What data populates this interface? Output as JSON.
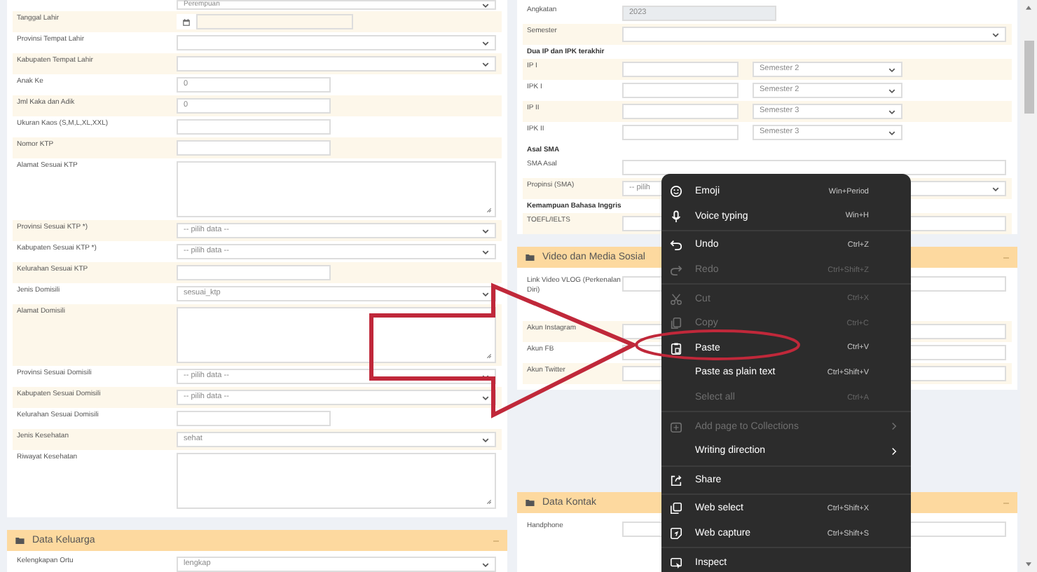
{
  "left_panel": {
    "fields": [
      {
        "kind": "select",
        "value": "Perempuan"
      },
      {
        "label": "Tanggal Lahir",
        "kind": "date"
      },
      {
        "label": "Provinsi Tempat Lahir",
        "kind": "select"
      },
      {
        "label": "Kabupaten Tempat Lahir",
        "kind": "select"
      },
      {
        "label": "Anak Ke",
        "kind": "short_input",
        "value": "0"
      },
      {
        "label": "Jml Kaka dan Adik",
        "kind": "short_input",
        "value": "0"
      },
      {
        "label": "Ukuran Kaos (S,M,L,XL,XXL)",
        "kind": "short_input"
      },
      {
        "label": "Nomor KTP",
        "kind": "short_input"
      },
      {
        "label": "Alamat Sesuai KTP",
        "kind": "textarea"
      },
      {
        "label": "Provinsi Sesuai KTP *)",
        "kind": "select",
        "value": "-- pilih data --"
      },
      {
        "label": "Kabupaten Sesuai KTP *)",
        "kind": "select",
        "value": "-- pilih data --"
      },
      {
        "label": "Kelurahan Sesuai KTP",
        "kind": "short_input"
      },
      {
        "label": "Jenis Domisili",
        "kind": "select",
        "value": "sesuai_ktp"
      },
      {
        "label": "Alamat Domisili",
        "kind": "textarea"
      },
      {
        "label": "Provinsi Sesuai Domisili",
        "kind": "select",
        "value": "-- pilih data --"
      },
      {
        "label": "Kabupaten Sesuai Domisili",
        "kind": "select",
        "value": "-- pilih data --"
      },
      {
        "label": "Kelurahan Sesuai Domisili",
        "kind": "short_input"
      },
      {
        "label": "Jenis Kesehatan",
        "kind": "select",
        "value": "sehat"
      },
      {
        "label": "Riwayat Kesehatan",
        "kind": "textarea"
      }
    ]
  },
  "left_sections": [
    {
      "title": "Data Keluarga",
      "fields": [
        {
          "label": "Kelengkapan Ortu",
          "kind": "select",
          "value": "lengkap"
        }
      ]
    }
  ],
  "right_panel": {
    "fields": [
      {
        "label": "Angkatan",
        "kind": "short_input",
        "value": "2023",
        "disabled": true
      },
      {
        "label": "Semester",
        "kind": "select"
      },
      {
        "label": "Dua IP dan IPK terakhir",
        "kind": "heading"
      },
      {
        "label": "IP I",
        "kind": "input_select",
        "value": "Semester 2"
      },
      {
        "label": "IPK I",
        "kind": "input_select",
        "value": "Semester 2"
      },
      {
        "label": "IP II",
        "kind": "input_select",
        "value": "Semester 3"
      },
      {
        "label": "IPK II",
        "kind": "input_select",
        "value": "Semester 3"
      },
      {
        "label": "Asal SMA",
        "kind": "heading"
      },
      {
        "label": "SMA Asal",
        "kind": "input"
      },
      {
        "label": "Propinsi (SMA)",
        "kind": "select",
        "value": "-- pilih"
      },
      {
        "label": "Kemampuan Bahasa Inggris",
        "kind": "heading"
      },
      {
        "label": "TOEFL/IELTS",
        "kind": "input"
      }
    ]
  },
  "right_sections": [
    {
      "title": "Video dan Media Sosial",
      "fields": [
        {
          "label": "Link Video VLOG (Perkenalan Diri)",
          "kind": "input"
        },
        {
          "label": "Akun Instagram",
          "kind": "input"
        },
        {
          "label": "Akun FB",
          "kind": "input"
        },
        {
          "label": "Akun Twitter",
          "kind": "input"
        }
      ]
    },
    {
      "title": "Data Kontak",
      "fields": [
        {
          "label": "Handphone",
          "kind": "input"
        }
      ]
    }
  ],
  "context_menu": {
    "groups": [
      [
        {
          "label": "Emoji",
          "shortcut": "Win+Period",
          "disabled": false,
          "submenu": false
        },
        {
          "label": "Voice typing",
          "shortcut": "Win+H",
          "disabled": false,
          "submenu": false
        }
      ],
      [
        {
          "label": "Undo",
          "shortcut": "Ctrl+Z",
          "disabled": false,
          "submenu": false
        },
        {
          "label": "Redo",
          "shortcut": "Ctrl+Shift+Z",
          "disabled": true,
          "submenu": false
        }
      ],
      [
        {
          "label": "Cut",
          "shortcut": "Ctrl+X",
          "disabled": true,
          "submenu": false
        },
        {
          "label": "Copy",
          "shortcut": "Ctrl+C",
          "disabled": true,
          "submenu": false
        },
        {
          "label": "Paste",
          "shortcut": "Ctrl+V",
          "disabled": false,
          "submenu": false
        },
        {
          "label": "Paste as plain text",
          "shortcut": "Ctrl+Shift+V",
          "disabled": false,
          "submenu": false
        },
        {
          "label": "Select all",
          "shortcut": "Ctrl+A",
          "disabled": true,
          "submenu": false
        }
      ],
      [
        {
          "label": "Add page to Collections",
          "disabled": true,
          "submenu": true
        },
        {
          "label": "Writing direction",
          "disabled": false,
          "submenu": true
        }
      ],
      [
        {
          "label": "Share",
          "disabled": false,
          "submenu": false
        }
      ],
      [
        {
          "label": "Web select",
          "shortcut": "Ctrl+Shift+X",
          "disabled": false,
          "submenu": false
        },
        {
          "label": "Web capture",
          "shortcut": "Ctrl+Shift+S",
          "disabled": false,
          "submenu": false
        }
      ],
      [
        {
          "label": "Inspect",
          "disabled": false,
          "submenu": false
        }
      ]
    ]
  }
}
